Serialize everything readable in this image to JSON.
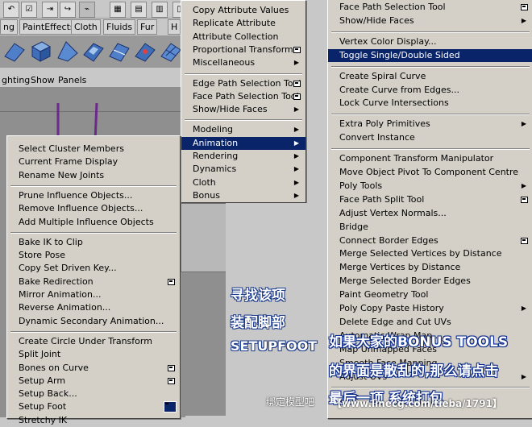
{
  "shelf_tabs": [
    "ng",
    "PaintEffects",
    "Cloth",
    "Fluids",
    "Fur",
    "H"
  ],
  "viewport_menu": [
    "ghting",
    "Show",
    "Panels"
  ],
  "col1_menu": {
    "items": [
      {
        "label": "Copy Attribute Values",
        "arrow": false,
        "option": false
      },
      {
        "label": "Replicate Attribute",
        "arrow": false,
        "option": false
      },
      {
        "label": "Attribute Collection",
        "arrow": false,
        "option": false
      },
      {
        "label": "Proportional Transform",
        "arrow": false,
        "option": true
      },
      {
        "label": "Miscellaneous",
        "arrow": true,
        "option": false
      },
      {
        "sep": true
      },
      {
        "label": "Edge Path Selection Tool",
        "arrow": false,
        "option": true
      },
      {
        "label": "Face Path Selection Tool",
        "arrow": false,
        "option": true
      },
      {
        "label": "Show/Hide Faces",
        "arrow": true,
        "option": false
      },
      {
        "sep": true
      },
      {
        "label": "Modeling",
        "arrow": true,
        "option": false
      },
      {
        "label": "Animation",
        "arrow": true,
        "option": false,
        "highlight": true
      },
      {
        "label": "Rendering",
        "arrow": true,
        "option": false
      },
      {
        "label": "Dynamics",
        "arrow": true,
        "option": false
      },
      {
        "label": "Cloth",
        "arrow": true,
        "option": false
      },
      {
        "label": "Bonus",
        "arrow": true,
        "option": false
      }
    ]
  },
  "anim_menu": {
    "items": [
      {
        "label": "Select Cluster Members",
        "option": false
      },
      {
        "label": "Current Frame Display",
        "option": false
      },
      {
        "label": "Rename New Joints",
        "option": false
      },
      {
        "sep": true
      },
      {
        "label": "Prune Influence Objects...",
        "option": false
      },
      {
        "label": "Remove Influence Objects...",
        "option": false
      },
      {
        "label": "Add Multiple Influence Objects",
        "option": false
      },
      {
        "sep": true
      },
      {
        "label": "Bake IK to Clip",
        "option": false
      },
      {
        "label": "Store Pose",
        "option": false
      },
      {
        "label": "Copy Set Driven Key...",
        "option": false
      },
      {
        "label": "Bake Redirection",
        "option": true
      },
      {
        "label": "Mirror Animation...",
        "option": false
      },
      {
        "label": "Reverse Animation...",
        "option": false
      },
      {
        "label": "Dynamic Secondary Animation...",
        "option": false
      },
      {
        "sep": true
      },
      {
        "label": "Create Circle Under Transform",
        "option": false
      },
      {
        "label": "Split Joint",
        "option": false
      },
      {
        "label": "Bones on Curve",
        "option": true
      },
      {
        "label": "Setup Arm",
        "option": true
      },
      {
        "label": "Setup Back...",
        "option": false
      },
      {
        "label": "Setup Foot",
        "option": true,
        "highlight_option": true
      },
      {
        "label": "Stretchy IK",
        "option": false
      }
    ]
  },
  "right_menu": {
    "items": [
      {
        "label": "Face Path Selection Tool",
        "arrow": false,
        "option": true
      },
      {
        "label": "Show/Hide Faces",
        "arrow": true,
        "option": false
      },
      {
        "sep": true
      },
      {
        "label": "Vertex Color Display...",
        "arrow": false,
        "option": false
      },
      {
        "label": "Toggle Single/Double Sided",
        "arrow": false,
        "option": false,
        "highlight": true
      },
      {
        "sep": true
      },
      {
        "label": "Create Spiral Curve",
        "arrow": false,
        "option": false
      },
      {
        "label": "Create Curve from Edges...",
        "arrow": false,
        "option": false
      },
      {
        "label": "Lock Curve Intersections",
        "arrow": false,
        "option": false
      },
      {
        "sep": true
      },
      {
        "label": "Extra Poly Primitives",
        "arrow": true,
        "option": false
      },
      {
        "label": "Convert Instance",
        "arrow": false,
        "option": false
      },
      {
        "sep": true
      },
      {
        "label": "Component Transform Manipulator",
        "arrow": false,
        "option": false
      },
      {
        "label": "Move Object Pivot To Component Centre",
        "arrow": false,
        "option": false
      },
      {
        "label": "Poly Tools",
        "arrow": true,
        "option": false
      },
      {
        "label": "Face Path Split Tool",
        "arrow": false,
        "option": true
      },
      {
        "label": "Adjust Vertex Normals...",
        "arrow": false,
        "option": false
      },
      {
        "label": "Bridge",
        "arrow": false,
        "option": false
      },
      {
        "label": "Connect Border Edges",
        "arrow": false,
        "option": true
      },
      {
        "label": "Merge Selected Vertices by Distance",
        "arrow": false,
        "option": false
      },
      {
        "label": "Merge Vertices by Distance",
        "arrow": false,
        "option": false
      },
      {
        "label": "Merge Selected Border Edges",
        "arrow": false,
        "option": false
      },
      {
        "label": "Paint Geometry Tool",
        "arrow": false,
        "option": false
      },
      {
        "label": "Poly Copy Paste History",
        "arrow": true,
        "option": false
      },
      {
        "label": "Delete Edge and Cut UVs",
        "arrow": false,
        "option": false
      },
      {
        "label": "Automatic Wrap Map...",
        "arrow": false,
        "option": false
      },
      {
        "label": "Map Unmapped Faces",
        "arrow": false,
        "option": false
      },
      {
        "label": "Smooth Face Mapping",
        "arrow": false,
        "option": false
      },
      {
        "label": "Adjust UVs",
        "arrow": true,
        "option": false
      },
      {
        "sep": true
      },
      {
        "label": "Help",
        "arrow": false,
        "option": false
      }
    ]
  },
  "annotations": {
    "line1": "寻找该项",
    "line2": "装配脚部",
    "line3": "SETUPFOOT",
    "blue1": "如果大家的BONUS TOOLS",
    "blue2": "的界面是散乱的,那么请点击",
    "blue3": "最后一项 系统打包"
  },
  "watermark": {
    "text1": "绑定模型吧",
    "text2": "【www.linecg.com/tieba/1791】"
  }
}
